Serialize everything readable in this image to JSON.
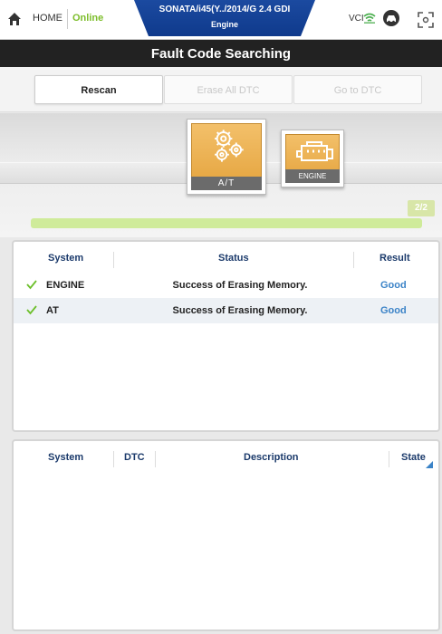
{
  "header": {
    "home_label": "HOME",
    "online_label": "Online",
    "vehicle_line1": "SONATA/i45(Y../2014/G 2.4 GDI",
    "vehicle_line2": "Engine",
    "vci_label": "VCI"
  },
  "title": "Fault Code Searching",
  "toolbar": {
    "rescan_label": "Rescan",
    "erase_label": "Erase All DTC",
    "goto_label": "Go to DTC"
  },
  "modules": {
    "at_label": "A/T",
    "engine_label": "ENGINE",
    "counter": "2/2"
  },
  "progress_fraction": 1.0,
  "result_table": {
    "headers": {
      "system": "System",
      "status": "Status",
      "result": "Result"
    },
    "rows": [
      {
        "system": "ENGINE",
        "status": "Success of Erasing Memory.",
        "result": "Good"
      },
      {
        "system": "AT",
        "status": "Success of Erasing Memory.",
        "result": "Good"
      }
    ]
  },
  "dtc_table": {
    "headers": {
      "system": "System",
      "dtc": "DTC",
      "description": "Description",
      "state": "State"
    }
  },
  "colors": {
    "online": "#7cbd2a",
    "vehicle_bg": "#1b4aa0",
    "title_bg": "#222222",
    "result_good": "#3b83c7",
    "progress": "#cfeb9a",
    "check": "#6cbf2a"
  }
}
